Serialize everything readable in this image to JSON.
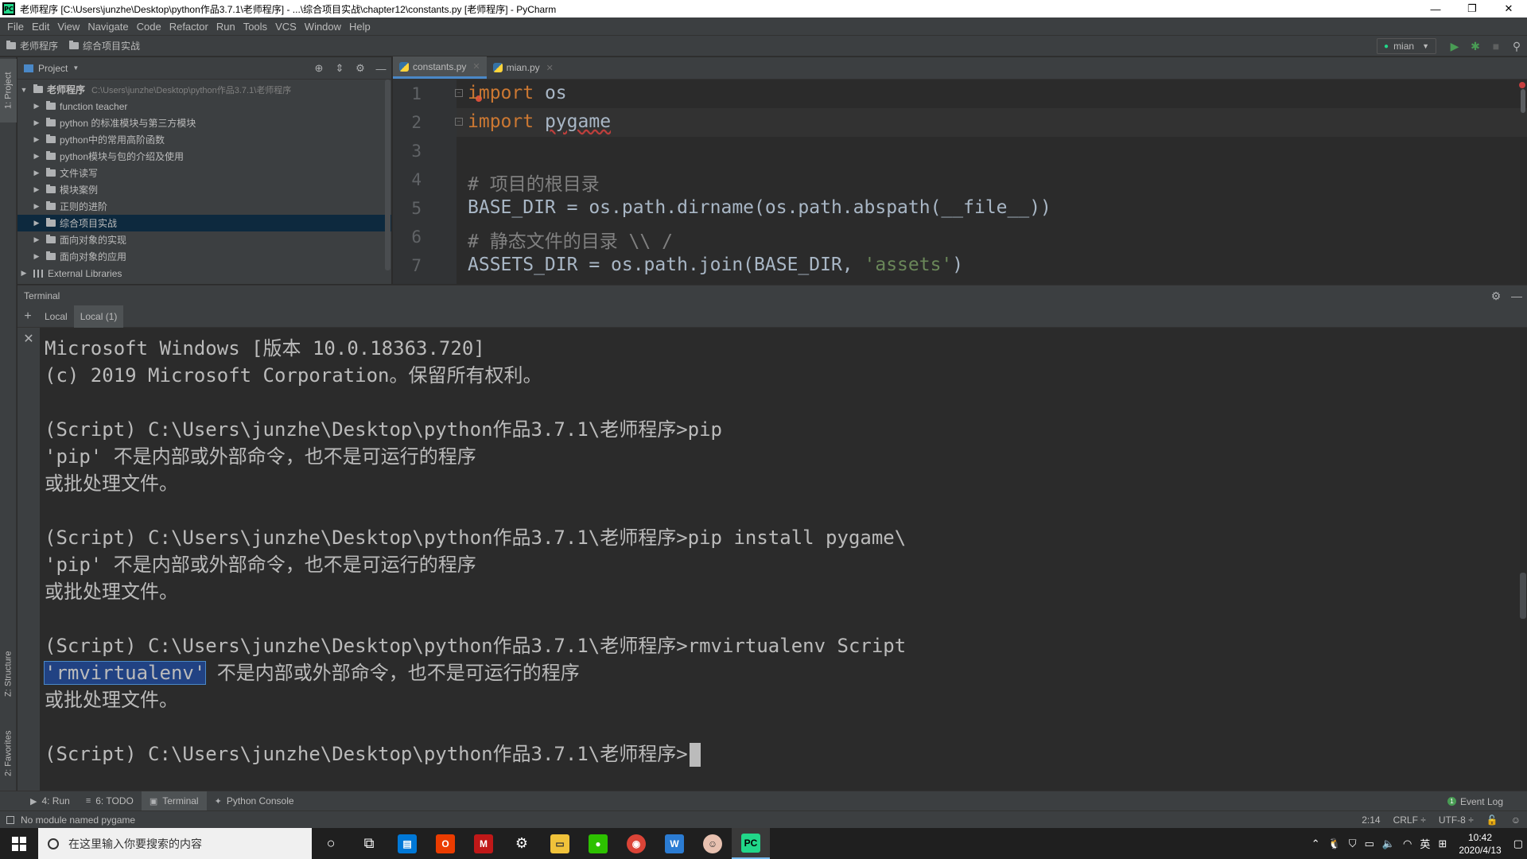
{
  "window": {
    "title": "老师程序 [C:\\Users\\junzhe\\Desktop\\python作品3.7.1\\老师程序] - ...\\综合项目实战\\chapter12\\constants.py [老师程序] - PyCharm",
    "app_icon": "PC",
    "minimize": "—",
    "maximize": "❐",
    "close": "✕"
  },
  "menu": [
    "File",
    "Edit",
    "View",
    "Navigate",
    "Code",
    "Refactor",
    "Run",
    "Tools",
    "VCS",
    "Window",
    "Help"
  ],
  "breadcrumb": [
    "老师程序",
    "综合项目实战"
  ],
  "run_config": "mian",
  "left_stripe": {
    "project": "1: Project",
    "structure": "Z: Structure",
    "favorites": "2: Favorites"
  },
  "project_panel": {
    "title": "Project",
    "root": {
      "name": "老师程序",
      "path": "C:\\Users\\junzhe\\Desktop\\python作品3.7.1\\老师程序"
    },
    "folders": [
      "function teacher",
      "python 的标准模块与第三方模块",
      "python中的常用高阶函数",
      "python模块与包的介绍及使用",
      "文件读写",
      "模块案例",
      "正则的进阶",
      "综合项目实战",
      "面向对象的实现",
      "面向对象的应用"
    ],
    "selected_index": 7,
    "external": "External Libraries"
  },
  "editor": {
    "tabs": [
      {
        "label": "constants.py",
        "active": true
      },
      {
        "label": "mian.py",
        "active": false
      }
    ],
    "line_numbers": [
      "1",
      "2",
      "3",
      "4",
      "5",
      "6",
      "7"
    ]
  },
  "terminal": {
    "title": "Terminal",
    "tabs": [
      "Local",
      "Local (1)"
    ],
    "lines": [
      "Microsoft Windows [版本 10.0.18363.720]",
      "(c) 2019 Microsoft Corporation。保留所有权利。",
      "",
      "(Script) C:\\Users\\junzhe\\Desktop\\python作品3.7.1\\老师程序>pip",
      "'pip' 不是内部或外部命令，也不是可运行的程序",
      "或批处理文件。",
      "",
      "(Script) C:\\Users\\junzhe\\Desktop\\python作品3.7.1\\老师程序>pip install pygame\\",
      "'pip' 不是内部或外部命令，也不是可运行的程序",
      "或批处理文件。",
      "",
      "(Script) C:\\Users\\junzhe\\Desktop\\python作品3.7.1\\老师程序>rmvirtualenv Script",
      "",
      "或批处理文件。",
      "",
      "(Script) C:\\Users\\junzhe\\Desktop\\python作品3.7.1\\老师程序>"
    ],
    "highlighted_token": "'rmvirtualenv'",
    "highlighted_rest": " 不是内部或外部命令，也不是可运行的程序"
  },
  "bottom_tabs": [
    {
      "icon": "▶",
      "label": "4: Run"
    },
    {
      "icon": "≡",
      "label": "6: TODO"
    },
    {
      "icon": "▣",
      "label": "Terminal"
    },
    {
      "icon": "✦",
      "label": "Python Console"
    }
  ],
  "event_log": "Event Log",
  "status": {
    "message": "No module named pygame",
    "position": "2:14",
    "line_sep": "CRLF ÷",
    "encoding": "UTF-8 ÷"
  },
  "taskbar": {
    "search_placeholder": "在这里输入你要搜索的内容",
    "ime": "英",
    "time": "10:42",
    "date": "2020/4/13"
  }
}
